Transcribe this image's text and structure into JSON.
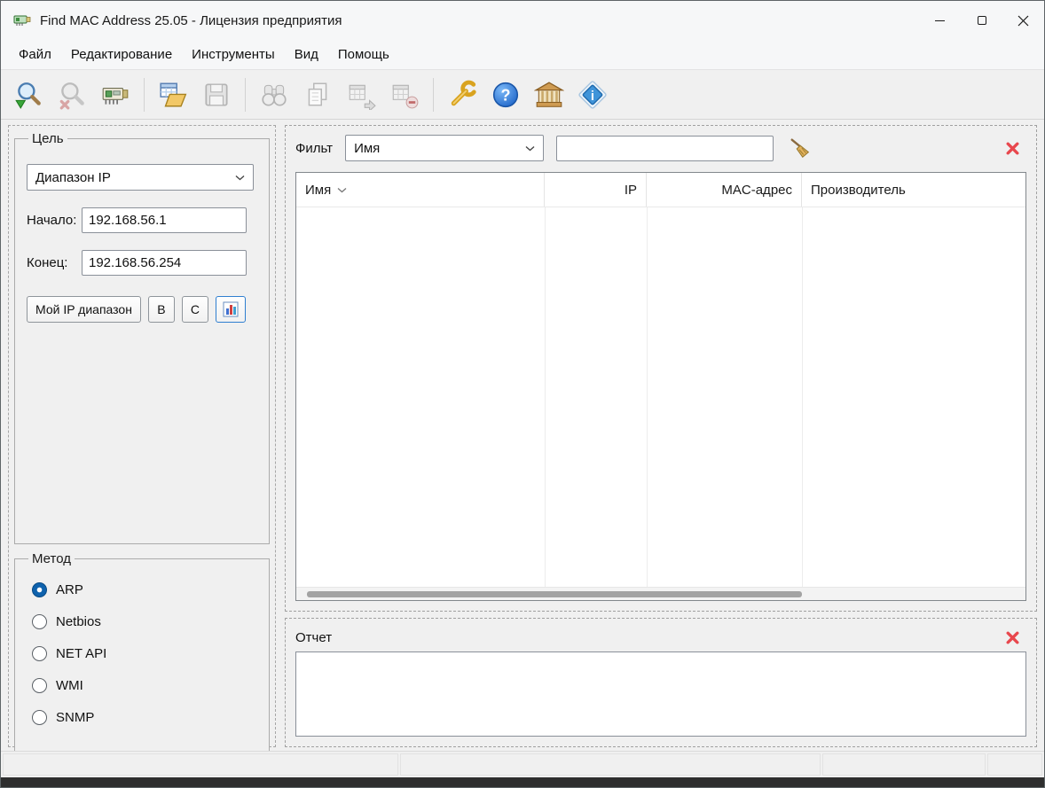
{
  "window": {
    "title": "Find MAC Address 25.05 - Лицензия предприятия"
  },
  "menu": {
    "items": [
      {
        "label": "Файл"
      },
      {
        "label": "Редактирование"
      },
      {
        "label": "Инструменты"
      },
      {
        "label": "Вид"
      },
      {
        "label": "Помощь"
      }
    ]
  },
  "toolbar": {
    "buttons": [
      {
        "name": "find",
        "icon": "search-start-icon",
        "enabled": true
      },
      {
        "name": "stop-find",
        "icon": "search-stop-icon",
        "enabled": false
      },
      {
        "name": "adapter-info",
        "icon": "network-adapter-icon",
        "enabled": true
      },
      {
        "name": "open-table",
        "icon": "table-open-icon",
        "enabled": true
      },
      {
        "name": "save-table",
        "icon": "save-icon",
        "enabled": false
      },
      {
        "name": "find-in-table",
        "icon": "binoculars-icon",
        "enabled": false
      },
      {
        "name": "copy",
        "icon": "copy-icon",
        "enabled": false
      },
      {
        "name": "export-table",
        "icon": "table-export-icon",
        "enabled": false
      },
      {
        "name": "remove-row",
        "icon": "table-remove-icon",
        "enabled": false
      },
      {
        "name": "settings",
        "icon": "wrench-icon",
        "enabled": true
      },
      {
        "name": "help",
        "icon": "help-icon",
        "enabled": true
      },
      {
        "name": "homepage",
        "icon": "home-icon",
        "enabled": true
      },
      {
        "name": "about",
        "icon": "info-diamond-icon",
        "enabled": true
      }
    ]
  },
  "target_panel": {
    "title": "Цель",
    "range_type_value": "Диапазон IP",
    "start_label": "Начало:",
    "start_value": "192.168.56.1",
    "end_label": "Конец:",
    "end_value": "192.168.56.254",
    "my_range_button": "Мой IP диапазон",
    "class_b_button": "B",
    "class_c_button": "C"
  },
  "method_panel": {
    "title": "Метод",
    "options": [
      {
        "label": "ARP",
        "selected": true
      },
      {
        "label": "Netbios",
        "selected": false
      },
      {
        "label": "NET API",
        "selected": false
      },
      {
        "label": "WMI",
        "selected": false
      },
      {
        "label": "SNMP",
        "selected": false
      }
    ]
  },
  "filter": {
    "label": "Фильт",
    "field_selected": "Имя",
    "query_value": ""
  },
  "results_table": {
    "columns": [
      {
        "label": "Имя",
        "sortable": true
      },
      {
        "label": "IP"
      },
      {
        "label": "MAC-адрес"
      },
      {
        "label": "Производитель"
      }
    ],
    "rows": []
  },
  "report": {
    "title": "Отчет",
    "content": ""
  },
  "colors": {
    "accent_blue": "#0f62ad",
    "danger_red": "#e8474d",
    "wrench_gold": "#d9a31f"
  }
}
